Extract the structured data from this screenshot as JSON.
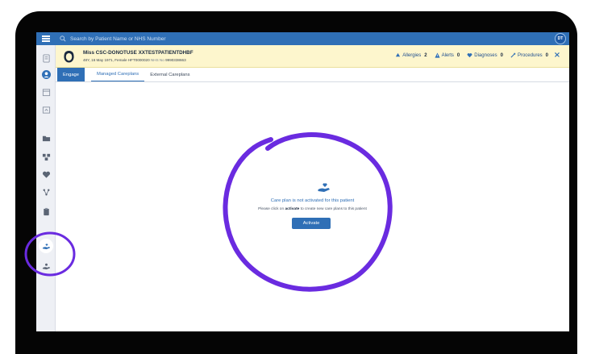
{
  "search": {
    "placeholder": "Search by Patient Name or NHS Number"
  },
  "user": {
    "initials": "DT"
  },
  "patient": {
    "name": "Miss CSC-DONOTUSE XXTESTPATIENTDHBF",
    "demographics": "48Y, 16 May 1971, Female HFT0000020",
    "nhs_label": "NHS No",
    "nhs_number": "9990338663"
  },
  "stats": {
    "allergies_label": "Allergies",
    "allergies_count": "2",
    "alerts_label": "Alerts",
    "alerts_count": "0",
    "diagnoses_label": "Diagnoses",
    "diagnoses_count": "0",
    "procedures_label": "Procedures",
    "procedures_count": "0"
  },
  "close_label": "×",
  "tabs": [
    {
      "label": "Engage"
    },
    {
      "label": "Managed Careplans"
    },
    {
      "label": "External Careplans"
    }
  ],
  "empty_state": {
    "title": "Care plan is not activated for this patient",
    "desc_prefix": "Please click on",
    "desc_keyword": "activate",
    "desc_suffix": "to create new care plans to this patient",
    "button_label": "Activate"
  },
  "colors": {
    "brand": "#2f6fb6",
    "banner": "#fdf6cd",
    "annotation": "#6a2be0",
    "frame": "#050505"
  },
  "icons": {
    "sidebar": [
      "menu-icon",
      "document-icon",
      "patient-icon",
      "calendar-icon",
      "note-icon",
      "folder-icon",
      "pathway-icon",
      "heart-icon",
      "diagram-icon",
      "clipboard-icon",
      "careplan-icon",
      "hand-icon"
    ]
  }
}
